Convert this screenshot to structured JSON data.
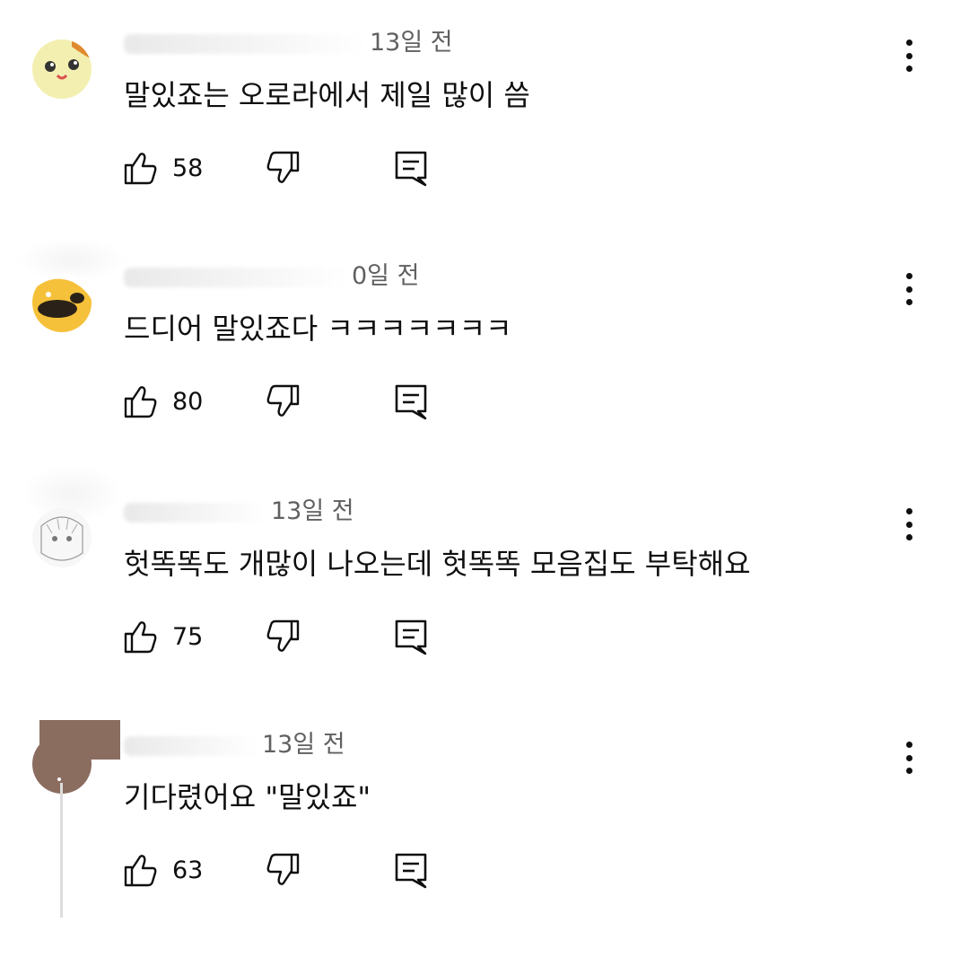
{
  "comments": [
    {
      "time": "13일 전",
      "text": "말있죠는 오로라에서 제일 많이 씀",
      "likes": "58",
      "avatar_color": "#f3efb0"
    },
    {
      "time": "0일 전",
      "text": "드디어 말있죠다 ㅋㅋㅋㅋㅋㅋㅋ",
      "likes": "80",
      "avatar_color": "#f6c13a"
    },
    {
      "time": "13일 전",
      "text": "헛똑똑도 개많이 나오는데 헛똑똑 모음집도 부탁해요",
      "likes": "75",
      "avatar_color": "#f1f1f1"
    },
    {
      "time": "13일 전",
      "text": "기다렸어요 \"말있죠\"",
      "likes": "63",
      "avatar_color": "#8b6d60"
    }
  ],
  "icons": {
    "like": "thumbs-up-icon",
    "dislike": "thumbs-down-icon",
    "reply": "reply-icon",
    "more": "more-vertical-icon"
  }
}
